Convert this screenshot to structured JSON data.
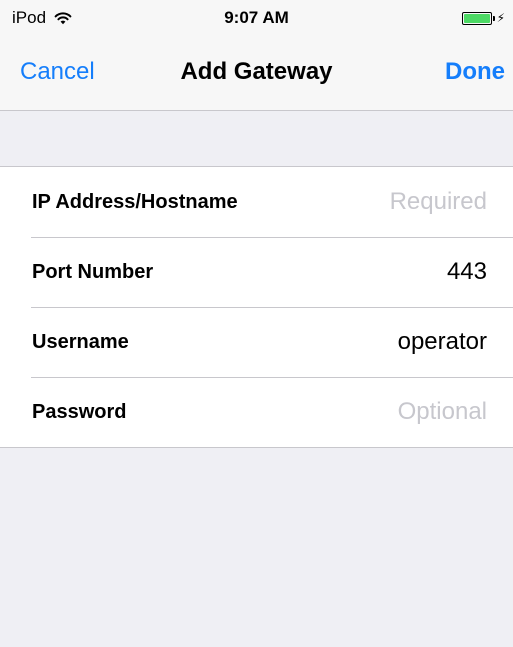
{
  "status_bar": {
    "carrier": "iPod",
    "time": "9:07 AM",
    "battery_color": "#4cd964"
  },
  "nav": {
    "cancel_label": "Cancel",
    "title": "Add Gateway",
    "done_label": "Done",
    "tint_color": "#157efb"
  },
  "form": {
    "rows": [
      {
        "label": "IP Address/Hostname",
        "value": "",
        "placeholder": "Required"
      },
      {
        "label": "Port Number",
        "value": "443",
        "placeholder": ""
      },
      {
        "label": "Username",
        "value": "operator",
        "placeholder": ""
      },
      {
        "label": "Password",
        "value": "",
        "placeholder": "Optional"
      }
    ]
  }
}
